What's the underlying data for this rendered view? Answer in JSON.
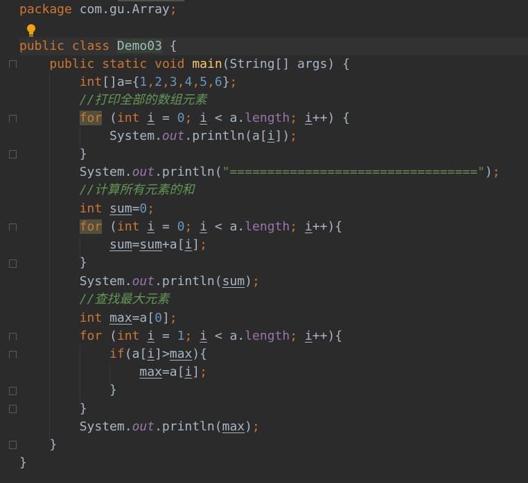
{
  "code": {
    "package_kw": "package",
    "package_name": "com.gu.Array",
    "semicolon": ";",
    "public": "public",
    "class": "class",
    "class_name": "Demo03",
    "open_brace": "{",
    "static": "static",
    "void": "void",
    "main": "main",
    "main_params": "(String[] args)",
    "int": "int",
    "arr_decl": "[]a={",
    "n1": "1",
    "n2": "2",
    "n3": "3",
    "n4": "4",
    "n5": "5",
    "n6": "6",
    "comma": ",",
    "close_brace_semi": "}",
    "comment1": "//打印全部的数组元素",
    "for": "for",
    "i": "i",
    "eq": " = ",
    "zero": "0",
    "one": "1",
    "lt": " < a.",
    "length": "length",
    "inc": "++",
    "paren_open_brace": ") {",
    "paren_close_brace": "){",
    "system": "System.",
    "out": "out",
    "println_a": ".println(a[",
    "close_idx_paren": "])",
    "close_brace": "}",
    "println_open": ".println(",
    "separator_str": "\"=================================\"",
    "close_paren": ")",
    "comment2": "//计算所有元素的和",
    "sum": "sum",
    "eq_nospace": "=",
    "plus_a": "+a[",
    "close_idx": "]",
    "comment3": "//查找最大元素",
    "max": "max",
    "a_idx_open": "a[",
    "if": "if",
    "paren_open": "(",
    "gt": "]>",
    "space": " "
  },
  "icons": {
    "bulb": "lightbulb-icon",
    "fold": "fold-marker-icon"
  },
  "colors": {
    "background": "#2b2b2b",
    "keyword": "#cc7832",
    "number": "#6897bb",
    "string": "#6a8759",
    "comment": "#629755",
    "method": "#ffc66d",
    "field": "#9876aa",
    "text": "#a9b7c6"
  }
}
